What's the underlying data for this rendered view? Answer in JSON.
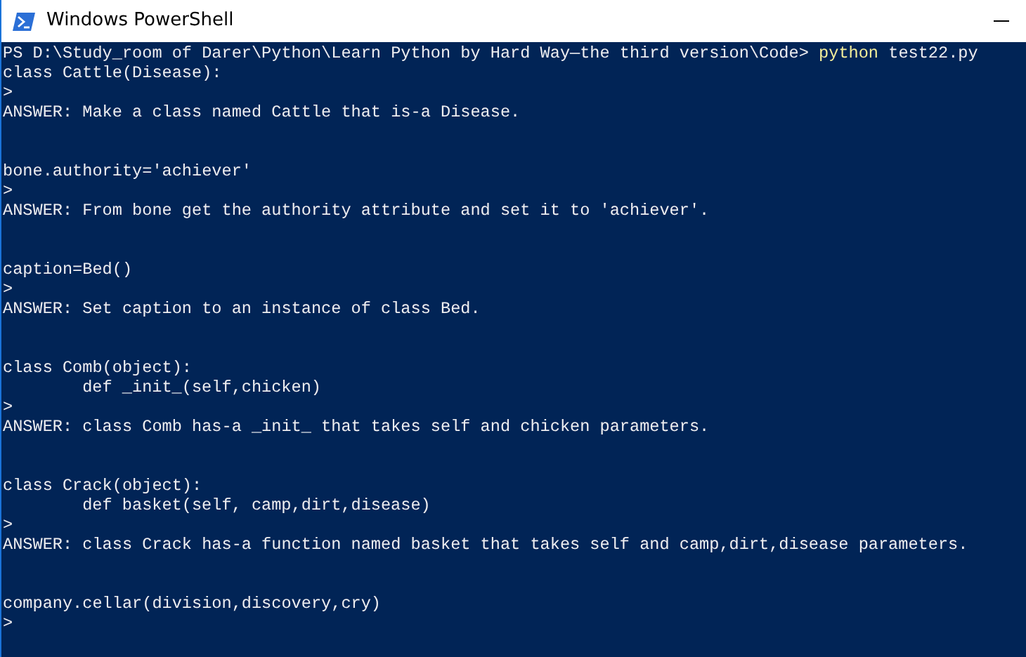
{
  "window": {
    "title": "Windows PowerShell"
  },
  "console": {
    "prompt": {
      "path": "PS D:\\Study_room of Darer\\Python\\Learn Python by Hard Way—the third version\\Code>",
      "command": "python",
      "argument": "test22.py"
    },
    "exercises": [
      {
        "code": [
          {
            "text": "class Cattle(Disease):"
          }
        ],
        "input": ">",
        "answer": "ANSWER: Make a class named Cattle that is-a Disease."
      },
      {
        "code": [
          {
            "text": "bone.authority='achiever'"
          }
        ],
        "input": ">",
        "answer": "ANSWER: From bone get the authority attribute and set it to 'achiever'."
      },
      {
        "code": [
          {
            "text": "caption=Bed()"
          }
        ],
        "input": ">",
        "answer": "ANSWER: Set caption to an instance of class Bed."
      },
      {
        "code": [
          {
            "text": "class Comb(object):",
            "children": [
              {
                "text": "def _init_(self,chicken)"
              }
            ]
          }
        ],
        "input": ">",
        "answer": "ANSWER: class Comb has-a _init_ that takes self and chicken parameters."
      },
      {
        "code": [
          {
            "text": "class Crack(object):",
            "children": [
              {
                "text": "def basket(self, camp,dirt,disease)"
              }
            ]
          }
        ],
        "input": ">",
        "answer": "ANSWER: class Crack has-a function named basket that takes self and camp,dirt,disease parameters."
      },
      {
        "code": [
          {
            "text": "company.cellar(division,discovery,cry)"
          }
        ],
        "input": ">"
      }
    ]
  }
}
